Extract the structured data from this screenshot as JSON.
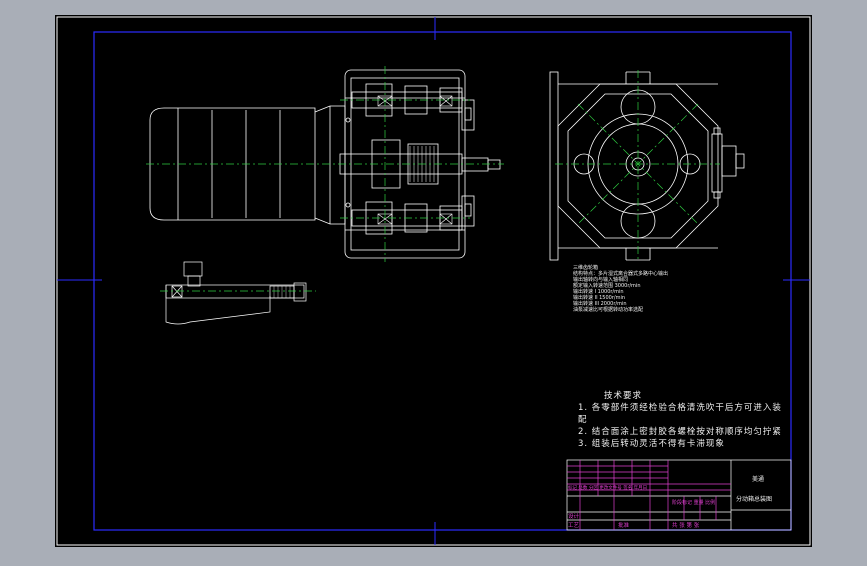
{
  "colors": {
    "background": "#a9aeb7",
    "canvas": "#000000",
    "frame": "#ffffff",
    "border": "#2b2bff",
    "centerline": "#2ecc40",
    "outline": "#ffffff",
    "title_block_magenta": "#e03fd0"
  },
  "notes": {
    "lines": [
      "三维齿轮箱",
      "结构特点：多片湿式离合器式多路中心输出",
      "输出轴转向与输入轴相同",
      "额定输入转速范围 3000r/min",
      "输出转速 I 1000r/min",
      "输出转速 II 1500r/min",
      "输出转速 III 2000r/min",
      "油泵减速比可根据转动功率选配"
    ]
  },
  "requirements": {
    "title": "技术要求",
    "lines": [
      "1. 各零部件须经检验合格清洗吹干后方可进入装",
      "配",
      "2. 结合面涂上密封胶各螺栓按对称顺序均匀拧紧",
      "3. 组装后转动灵活不得有卡滞现象"
    ]
  },
  "title_block": {
    "name_line1": "美通",
    "name_line2": "分动箱总装图",
    "header_row": "标记 处数 分区 更改文件号 签名 年月日",
    "mid_row": "阶段标记 重量 比例",
    "design_label": "设计",
    "process_label": "工艺",
    "approve_label": "批准",
    "sheet_row": "共 张 第 张"
  }
}
